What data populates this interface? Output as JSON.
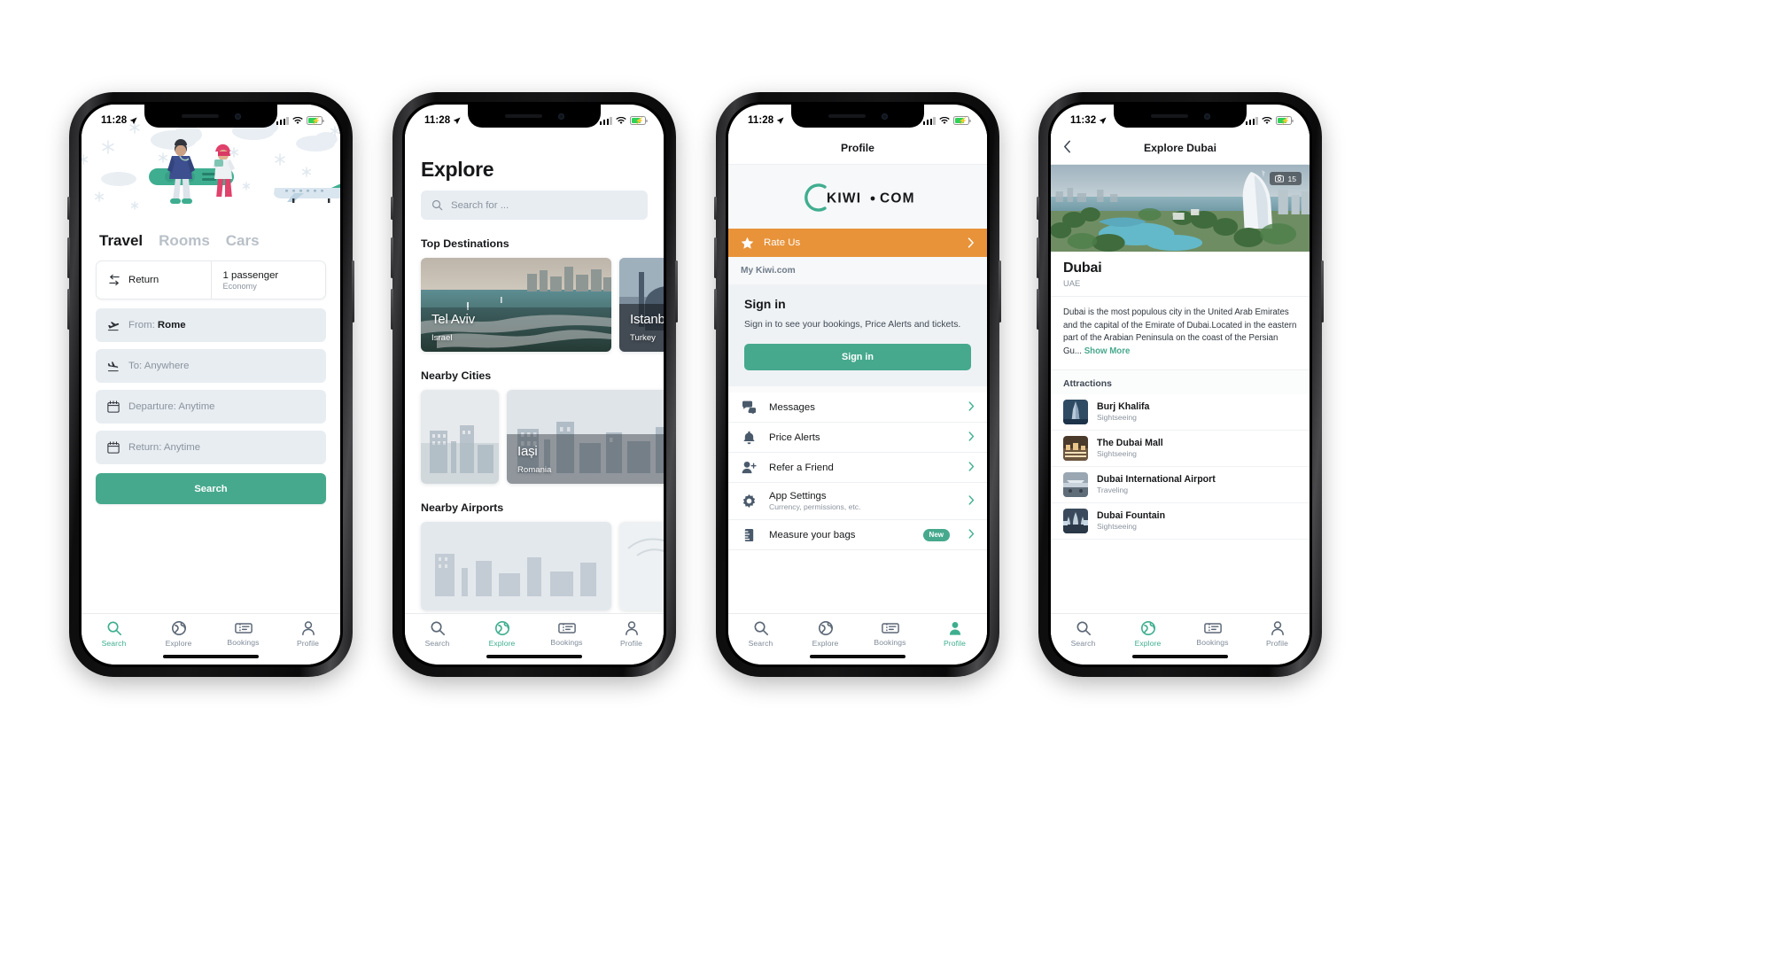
{
  "phones": [
    {
      "id": "search",
      "status": {
        "time": "11:28",
        "location_arrow": "location-arrow-icon"
      },
      "tabs": [
        {
          "label": "Travel",
          "active": true
        },
        {
          "label": "Rooms",
          "active": false
        },
        {
          "label": "Cars",
          "active": false
        }
      ],
      "trip_type": "Return",
      "passengers": "1 passenger",
      "cabin": "Economy",
      "fields": [
        {
          "icon": "takeoff-icon",
          "label": "From:",
          "value": "Rome"
        },
        {
          "icon": "landing-icon",
          "label": "To:",
          "value": "Anywhere"
        },
        {
          "icon": "calendar-icon",
          "label": "Departure:",
          "value": "Anytime"
        },
        {
          "icon": "calendar-icon",
          "label": "Return:",
          "value": "Anytime"
        }
      ],
      "search_button": "Search",
      "tabbar": [
        {
          "label": "Search",
          "icon": "search-icon",
          "active": true
        },
        {
          "label": "Explore",
          "icon": "globe-icon",
          "active": false
        },
        {
          "label": "Bookings",
          "icon": "ticket-icon",
          "active": false
        },
        {
          "label": "Profile",
          "icon": "person-icon",
          "active": false
        }
      ]
    },
    {
      "id": "explore",
      "status": {
        "time": "11:28"
      },
      "title": "Explore",
      "search_placeholder": "Search for ...",
      "sections": [
        {
          "heading": "Top Destinations",
          "cards": [
            {
              "name": "Tel Aviv",
              "country": "Israel"
            },
            {
              "name": "Istanbul",
              "country": "Turkey"
            }
          ]
        },
        {
          "heading": "Nearby Cities",
          "cards": [
            {
              "name": "",
              "country": ""
            },
            {
              "name": "Iași",
              "country": "Romania"
            }
          ]
        },
        {
          "heading": "Nearby Airports",
          "cards": [
            {
              "name": "",
              "country": ""
            },
            {
              "name": "",
              "country": ""
            }
          ]
        }
      ],
      "tabbar": [
        {
          "label": "Search",
          "icon": "search-icon",
          "active": false
        },
        {
          "label": "Explore",
          "icon": "globe-icon",
          "active": true
        },
        {
          "label": "Bookings",
          "icon": "ticket-icon",
          "active": false
        },
        {
          "label": "Profile",
          "icon": "person-icon",
          "active": false
        }
      ]
    },
    {
      "id": "profile",
      "status": {
        "time": "11:28"
      },
      "navbar_title": "Profile",
      "logo": "KIWI·COM",
      "rate_us": "Rate Us",
      "section_label": "My Kiwi.com",
      "signin": {
        "title": "Sign in",
        "body": "Sign in to see your bookings, Price Alerts and tickets.",
        "button": "Sign in"
      },
      "menu": [
        {
          "label": "Messages",
          "sub": "",
          "icon": "chat-icon",
          "badge": ""
        },
        {
          "label": "Price Alerts",
          "sub": "",
          "icon": "bell-icon",
          "badge": ""
        },
        {
          "label": "Refer a Friend",
          "sub": "",
          "icon": "person-add-icon",
          "badge": ""
        },
        {
          "label": "App Settings",
          "sub": "Currency, permissions, etc.",
          "icon": "gear-icon",
          "badge": ""
        },
        {
          "label": "Measure your bags",
          "sub": "",
          "icon": "ruler-icon",
          "badge": "New"
        }
      ],
      "tabbar": [
        {
          "label": "Search",
          "icon": "search-icon",
          "active": false
        },
        {
          "label": "Explore",
          "icon": "globe-icon",
          "active": false
        },
        {
          "label": "Bookings",
          "icon": "ticket-icon",
          "active": false
        },
        {
          "label": "Profile",
          "icon": "person-icon",
          "active": true
        }
      ]
    },
    {
      "id": "dubai",
      "status": {
        "time": "11:32"
      },
      "navbar_title": "Explore Dubai",
      "photo_count": "15",
      "city": "Dubai",
      "country": "UAE",
      "description": "Dubai is the most populous city in the United Arab Emirates and the capital of the Emirate of Dubai.Located in the eastern part of the Arabian Peninsula on the coast of the Persian Gu...",
      "show_more": "Show More",
      "attractions_heading": "Attractions",
      "attractions": [
        {
          "name": "Burj Khalifa",
          "category": "Sightseeing"
        },
        {
          "name": "The Dubai Mall",
          "category": "Sightseeing"
        },
        {
          "name": "Dubai International Airport",
          "category": "Traveling"
        },
        {
          "name": "Dubai Fountain",
          "category": "Sightseeing"
        }
      ],
      "tabbar": [
        {
          "label": "Search",
          "icon": "search-icon",
          "active": false
        },
        {
          "label": "Explore",
          "icon": "globe-icon",
          "active": true
        },
        {
          "label": "Bookings",
          "icon": "ticket-icon",
          "active": false
        },
        {
          "label": "Profile",
          "icon": "person-icon",
          "active": false
        }
      ]
    }
  ],
  "colors": {
    "brand_green": "#46a98d",
    "accent_orange": "#e8933a",
    "text_dark": "#17181a",
    "text_muted": "#8b949f",
    "field_bg": "#e8edf2"
  }
}
